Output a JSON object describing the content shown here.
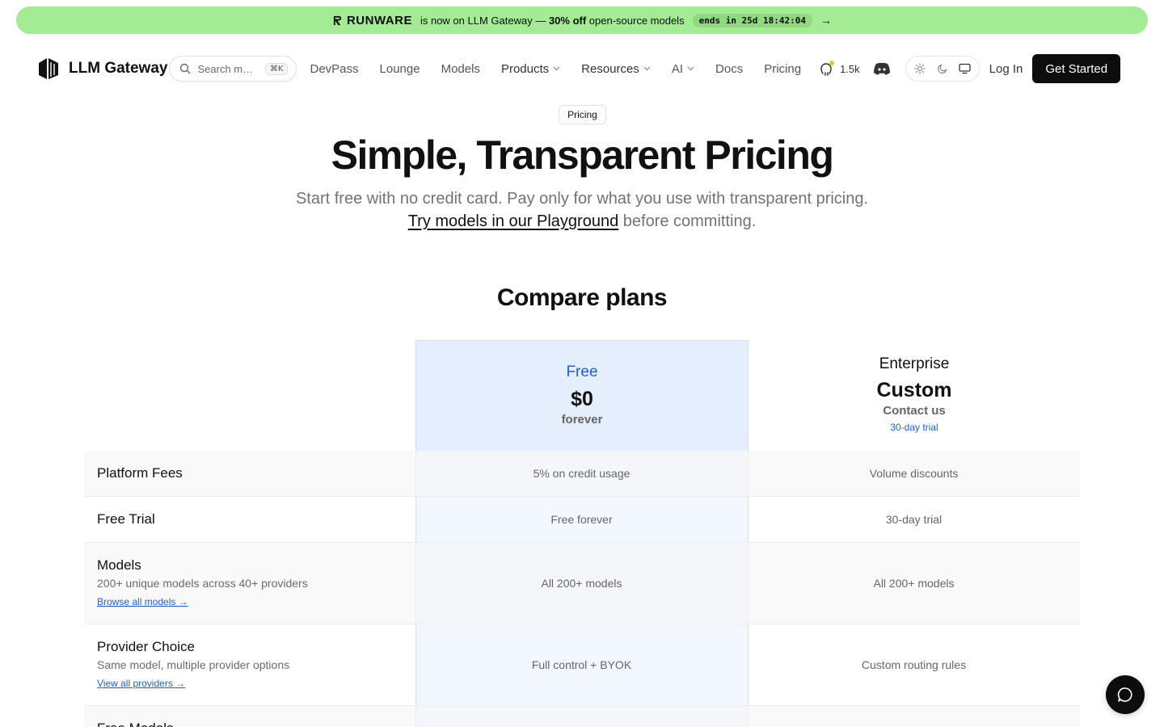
{
  "promo": {
    "brand": "RUNWARE",
    "message_prefix": "is now on LLM Gateway — ",
    "message_bold": "30% off",
    "message_suffix": " open-source models",
    "timer": "ends in 25d 18:42:04",
    "arrow": "→",
    "color": "#a3ec94"
  },
  "nav": {
    "logo_text": "LLM Gateway",
    "search_placeholder": "Search m…",
    "search_shortcut": "⌘K",
    "links": [
      {
        "label": "DevPass"
      },
      {
        "label": "Lounge"
      },
      {
        "label": "Models"
      },
      {
        "label": "Products"
      },
      {
        "label": "Resources"
      },
      {
        "label": "AI"
      },
      {
        "label": "Docs"
      },
      {
        "label": "Pricing"
      }
    ],
    "github_stars": "1.5k",
    "login": "Log In",
    "cta": "Get Started"
  },
  "hero": {
    "badge": "Pricing",
    "title": "Simple, Transparent Pricing",
    "subtitle_prefix": "Start free with no credit card. Pay only for what you use with transparent pricing. ",
    "subtitle_link": "Try models in our Playground",
    "subtitle_suffix": " before committing."
  },
  "compare": {
    "title": "Compare plans",
    "plans": {
      "free": {
        "name": "Free",
        "price": "$0",
        "period": "forever"
      },
      "enterprise": {
        "name": "Enterprise",
        "price": "Custom",
        "contact": "Contact us",
        "trial": "30-day trial"
      }
    },
    "rows": [
      {
        "name": "Platform Fees",
        "desc": "",
        "link": "",
        "free": "5% on credit usage",
        "enterprise": "Volume discounts"
      },
      {
        "name": "Free Trial",
        "desc": "",
        "link": "",
        "free": "Free forever",
        "enterprise": "30-day trial"
      },
      {
        "name": "Models",
        "desc": "200+ unique models across 40+ providers",
        "link": "Browse all models →",
        "free": "All 200+ models",
        "enterprise": "All 200+ models"
      },
      {
        "name": "Provider Choice",
        "desc": "Same model, multiple provider options",
        "link": "View all providers →",
        "free": "Full control + BYOK",
        "enterprise": "Custom routing rules"
      },
      {
        "name": "Free Models",
        "desc": "",
        "link": "",
        "free": "",
        "enterprise": ""
      }
    ],
    "accent": "#1d5fd6"
  }
}
